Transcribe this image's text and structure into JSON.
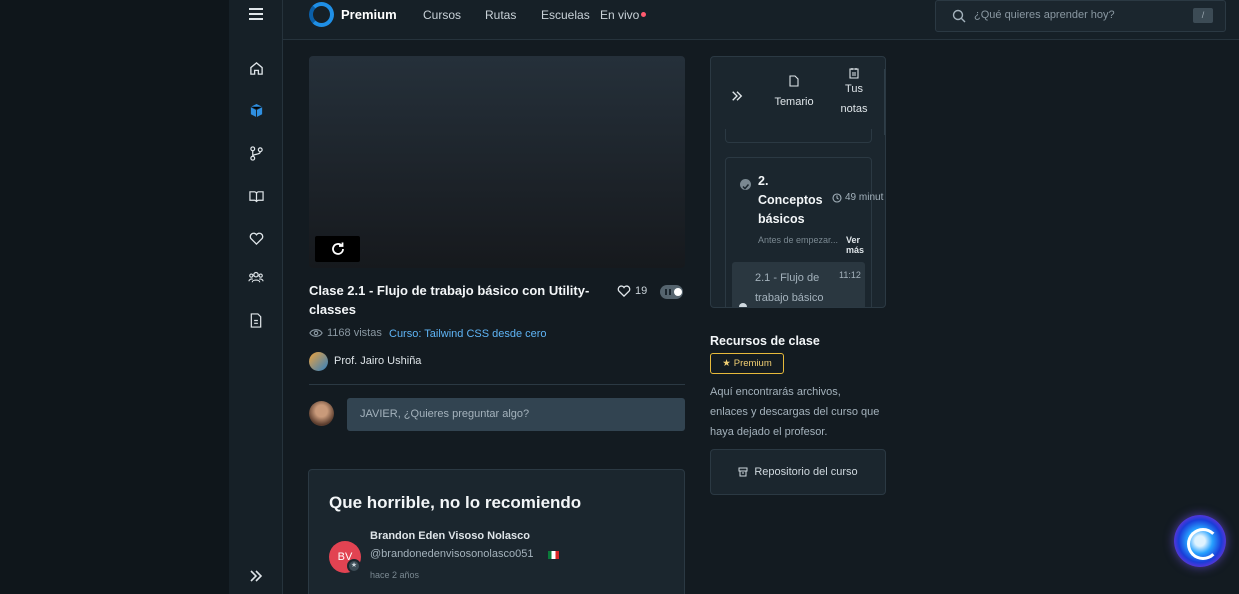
{
  "topbar": {
    "brand": "Premium",
    "nav": [
      "Cursos",
      "Rutas",
      "Escuelas",
      "En vivo"
    ],
    "search_placeholder": "¿Qué quieres aprender hoy?",
    "search_shortcut": "/"
  },
  "sidebar": {
    "icons": [
      "menu-icon",
      "home-icon",
      "cube-icon",
      "git-branch-icon",
      "book-icon",
      "heart-icon",
      "users-icon",
      "document-icon",
      "expand-icon"
    ]
  },
  "video": {
    "title": "Clase 2.1 - Flujo de trabajo básico con Utility-classes",
    "likes": "19",
    "views": "1168 vistas",
    "course_link": "Curso: Tailwind CSS desde cero",
    "professor": "Prof. Jairo Ushiña"
  },
  "comment": {
    "placeholder": "JAVIER, ¿Quieres preguntar algo?"
  },
  "review": {
    "title": "Que horrible, no lo recomiendo",
    "author": "Brandon Eden Visoso Nolasco",
    "initials": "BV",
    "handle": "@brandonedenvisosonolasco051",
    "time": "hace 2 años"
  },
  "panel": {
    "tab_syllabus": "Temario",
    "tab_notes_1": "Tus",
    "tab_notes_2": "notas",
    "module_title": "2. Conceptos básicos",
    "module_duration": "49 minut",
    "module_desc": "Antes de empezar...",
    "see_more": "Ver más",
    "lesson_title": "2.1 - Flujo de trabajo básico",
    "lesson_time": "11:12"
  },
  "resources": {
    "title": "Recursos de clase",
    "badge": "Premium",
    "description": "Aquí encontrarás archivos, enlaces y descargas del curso que haya dejado el profesor.",
    "repo_button": "Repositorio del curso"
  },
  "colors": {
    "accent": "#1f8fe6",
    "link": "#5fb4f5",
    "premium": "#e6b93b",
    "live": "#ff5a6e"
  }
}
